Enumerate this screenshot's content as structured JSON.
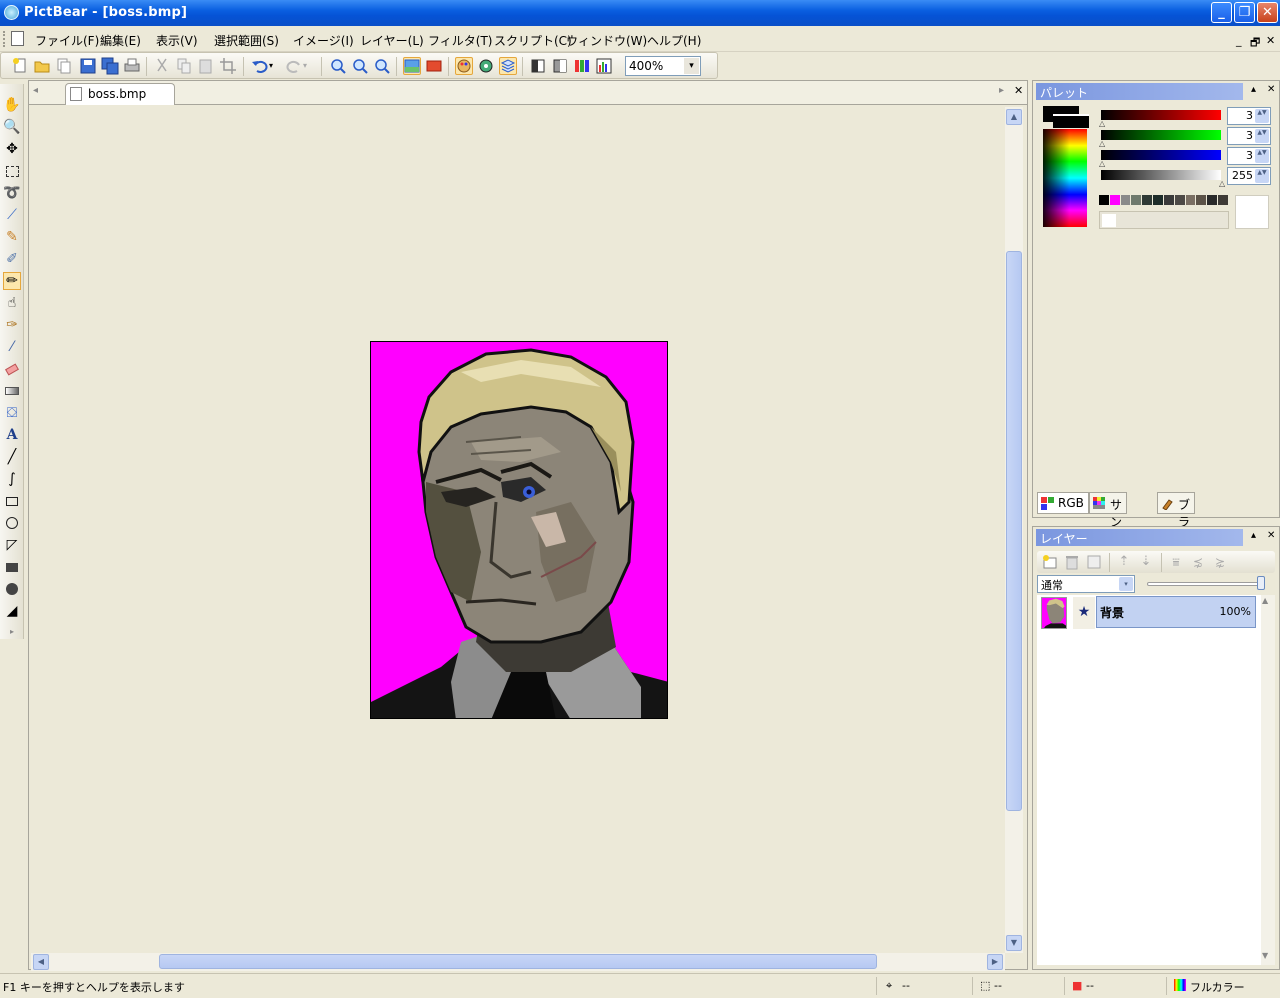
{
  "window": {
    "title": "PictBear - [boss.bmp]",
    "buttons": {
      "minimize": "_",
      "maximize": "❐",
      "close": "✕"
    }
  },
  "menubar": {
    "items": [
      "ファイル(F)",
      "編集(E)",
      "表示(V)",
      "選択範囲(S)",
      "イメージ(I)",
      "レイヤー(L)",
      "フィルタ(T)",
      "スクリプト(C)",
      "ウィンドウ(W)",
      "ヘルプ(H)"
    ],
    "mdi_controls": {
      "minimize": "_",
      "restore": "🗗",
      "close": "✕"
    }
  },
  "toolbar": {
    "zoom_value": "400%",
    "zoom_arrow": "▾"
  },
  "document": {
    "tab_label": "boss.bmp",
    "scroll_arrows": {
      "up": "▲",
      "down": "▼",
      "left": "◀",
      "right": "▶"
    },
    "tab_nav": {
      "left": "◂",
      "right": "▸",
      "close": "✕"
    }
  },
  "palette_panel": {
    "title": "パレット",
    "red_value": "3",
    "green_value": "3",
    "blue_value": "3",
    "alpha_value": "255",
    "tabs": [
      "RGB",
      "サンプル",
      "ブラシ"
    ],
    "pin": "▴",
    "close": "✕",
    "spin_arrows": "▲▼",
    "marker": "△",
    "swatches": [
      "#000000",
      "#ff00ff",
      "#8a8a8a",
      "#6f7a6d",
      "#2f3a36",
      "#1e2d2a",
      "#3a3a3a",
      "#4d4a46",
      "#7a6f63",
      "#5c5348",
      "#2a2a2a",
      "#3e3b37"
    ]
  },
  "layer_panel": {
    "title": "レイヤー",
    "blend_mode": "通常",
    "blend_arrow": "▾",
    "pin": "▴",
    "close": "✕",
    "layers": [
      {
        "name": "背景",
        "opacity": "100%",
        "star": "★"
      }
    ]
  },
  "statusbar": {
    "help_text": "F1 キーを押すとヘルプを表示します",
    "cursor_pos": "--",
    "selection_size": "--",
    "color_value": "--",
    "color_mode": "フルカラー"
  },
  "colors": {
    "title_blue": "#0a5fe0",
    "magenta_bg": "#ff00ff",
    "panel_bg": "#ece9d8",
    "selection_blue": "#c2d2f2"
  }
}
